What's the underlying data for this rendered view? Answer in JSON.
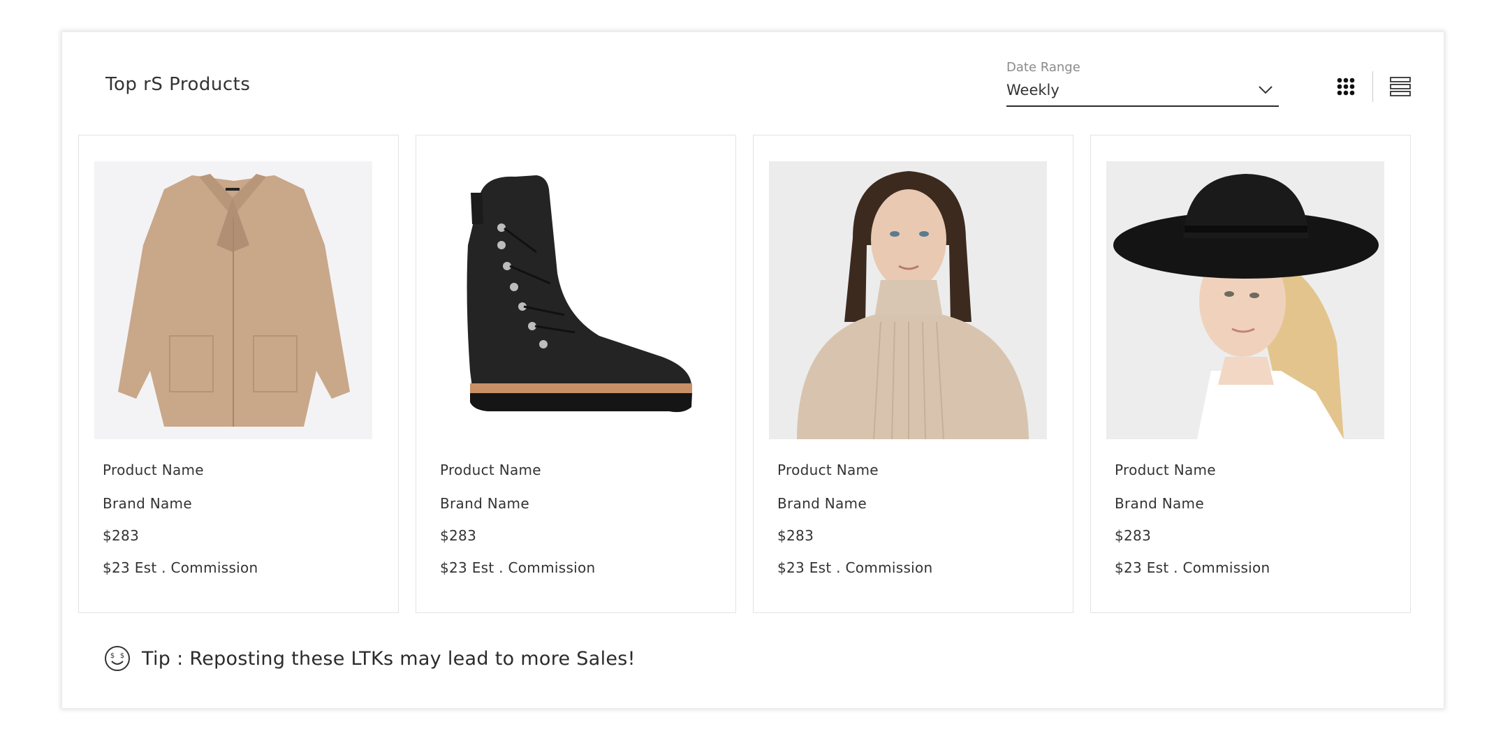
{
  "header": {
    "title": "Top rS Products"
  },
  "date_range": {
    "label": "Date Range",
    "value": "Weekly",
    "icon": "chevron-down-icon"
  },
  "view_toggle": {
    "grid_icon": "grid-view-icon",
    "list_icon": "list-view-icon",
    "active": "grid"
  },
  "products": [
    {
      "image": "tan-cardigan-coat",
      "name": "Product Name",
      "brand": "Brand Name",
      "price": "$283",
      "commission": "$23 Est . Commission"
    },
    {
      "image": "black-lace-up-boot",
      "name": "Product Name",
      "brand": "Brand Name",
      "price": "$283",
      "commission": "$23 Est . Commission"
    },
    {
      "image": "model-beige-turtleneck-sweater",
      "name": "Product Name",
      "brand": "Brand Name",
      "price": "$283",
      "commission": "$23 Est . Commission"
    },
    {
      "image": "model-black-wide-brim-hat",
      "name": "Product Name",
      "brand": "Brand Name",
      "price": "$283",
      "commission": "$23 Est . Commission"
    }
  ],
  "tip": {
    "icon": "money-face-icon",
    "text": "Tip : Reposting these LTKs may lead to more Sales!"
  },
  "colors": {
    "text": "#333333",
    "muted": "#8a8a8a",
    "border": "#e3e3e3",
    "underline": "#2b2b2b"
  }
}
